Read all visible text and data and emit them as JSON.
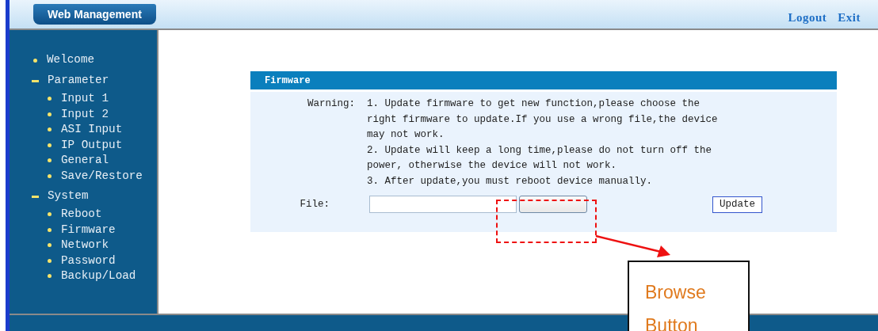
{
  "header": {
    "title": "Web Management",
    "links": [
      "Logout",
      "Exit"
    ]
  },
  "sidebar": {
    "items": [
      {
        "label": "Welcome",
        "kind": "link"
      },
      {
        "label": "Parameter",
        "kind": "group",
        "expanded": true,
        "children": [
          {
            "label": "Input 1"
          },
          {
            "label": "Input 2"
          },
          {
            "label": "ASI Input"
          },
          {
            "label": "IP Output"
          },
          {
            "label": "General"
          },
          {
            "label": "Save/Restore"
          }
        ]
      },
      {
        "label": "System",
        "kind": "group",
        "expanded": true,
        "children": [
          {
            "label": "Reboot"
          },
          {
            "label": "Firmware"
          },
          {
            "label": "Network"
          },
          {
            "label": "Password"
          },
          {
            "label": "Backup/Load"
          }
        ]
      }
    ]
  },
  "panel": {
    "title": "Firmware",
    "warning_label": "Warning:",
    "warnings": [
      "1. Update firmware to get new function,please choose the right firmware to update.If you use a wrong file,the device may not work.",
      "2. Update will keep a long time,please do not turn off the power, otherwise the device will not work.",
      "3. After update,you must reboot device manually."
    ],
    "file_label": "File:",
    "update_button": "Update"
  },
  "annotation": {
    "label": "Browse Button"
  }
}
